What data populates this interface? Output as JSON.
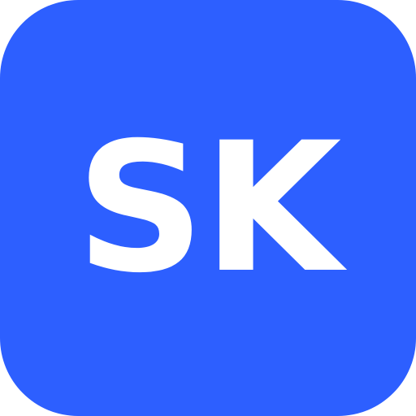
{
  "icon": {
    "monogram": "SK",
    "background_color": "#2d5fff",
    "text_color": "#ffffff"
  }
}
